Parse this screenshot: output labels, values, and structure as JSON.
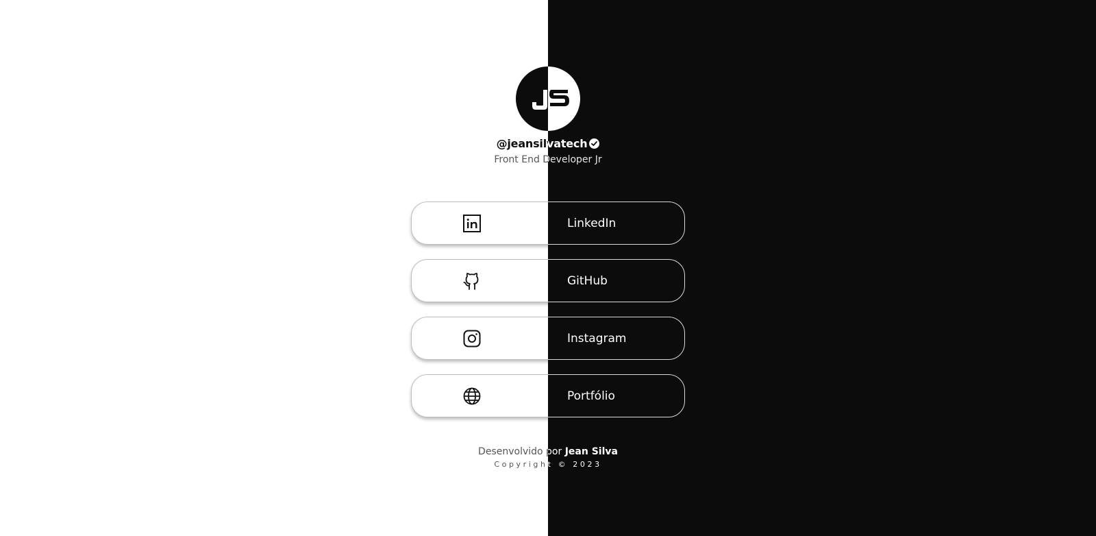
{
  "profile": {
    "avatar_initials": "JS",
    "handle": "@jeansilvatech",
    "verified_icon": "verified-check-icon",
    "subtitle": "Front End Developer Jr"
  },
  "links": [
    {
      "label": "LinkedIn",
      "icon": "linkedin-icon"
    },
    {
      "label": "GitHub",
      "icon": "github-icon"
    },
    {
      "label": "Instagram",
      "icon": "instagram-icon"
    },
    {
      "label": "Portfólio",
      "icon": "globe-icon"
    }
  ],
  "footer": {
    "credit_prefix": "Desenvolvido por ",
    "credit_author": "Jean Silva",
    "copyright": "Copyright © 2023"
  },
  "colors": {
    "light_bg": "#ffffff",
    "dark_bg": "#0c0c0c"
  }
}
